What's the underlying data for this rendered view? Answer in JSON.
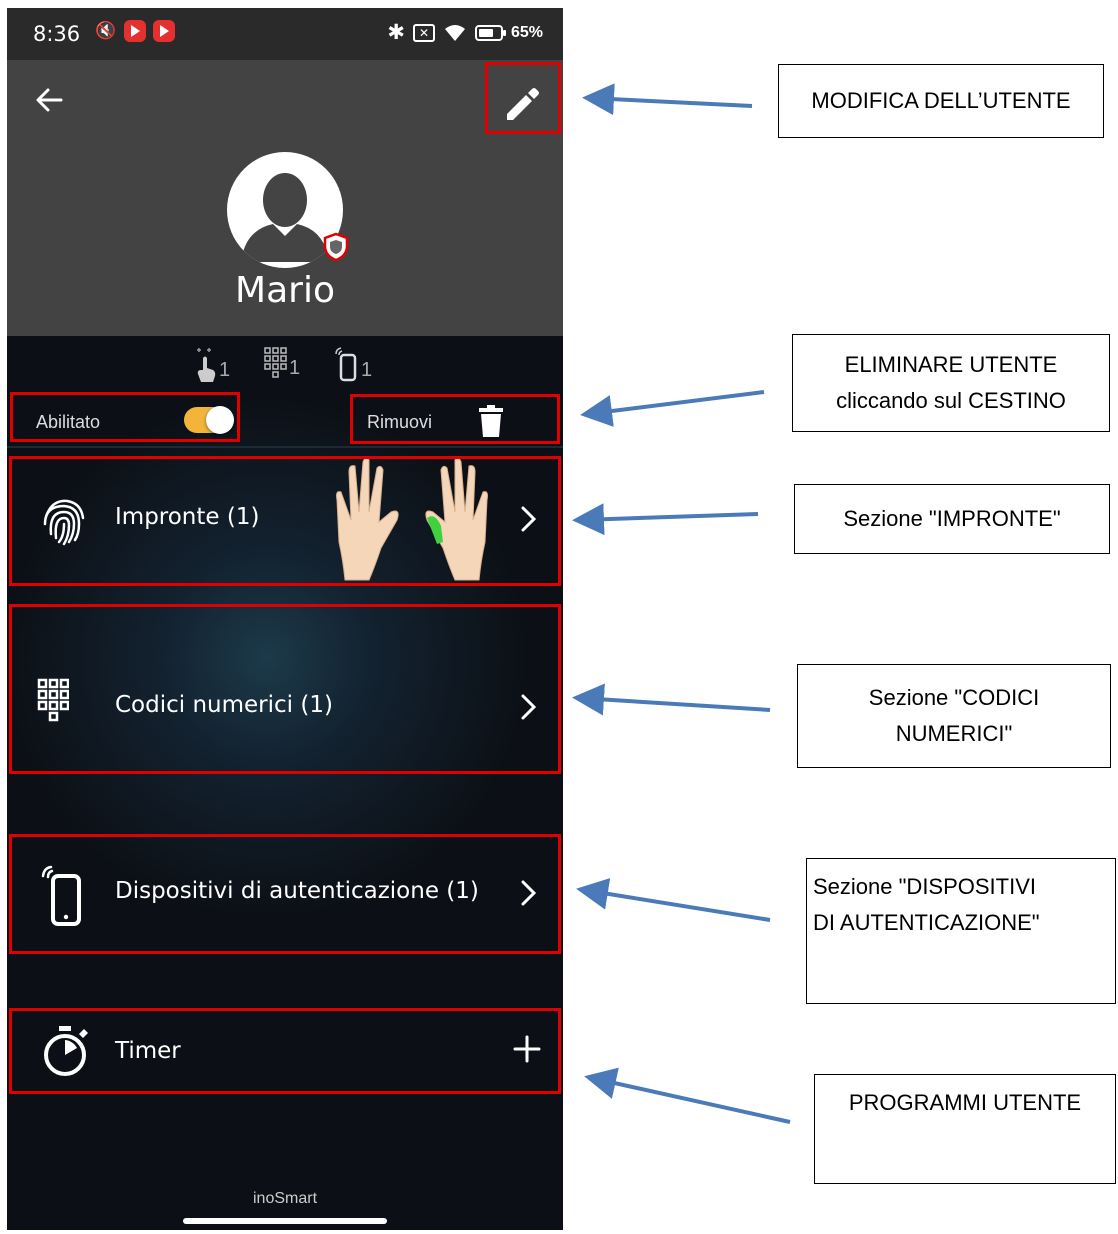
{
  "status_bar": {
    "time": "8:36",
    "battery": "65%"
  },
  "user": {
    "name": "Mario"
  },
  "counts": {
    "fingerprints": "1",
    "codes": "1",
    "devices": "1"
  },
  "controls": {
    "enabled_label": "Abilitato",
    "enabled": true,
    "remove_label": "Rimuovi"
  },
  "sections": {
    "fingerprints": "Impronte (1)",
    "codes": "Codici numerici (1)",
    "devices": "Dispositivi di autenticazione (1)",
    "timer": "Timer"
  },
  "footer": {
    "brand": "inoSmart"
  },
  "colors": {
    "highlight": "#e00000",
    "arrow": "#4a7ab8",
    "toggle": "#f2b53a",
    "header": "#434343"
  },
  "annotations": {
    "edit_user": "MODIFICA DELL’UTENTE",
    "delete_user_line1": "ELIMINARE UTENTE",
    "delete_user_line2": "cliccando sul CESTINO",
    "fingerprints_section": "Sezione \"IMPRONTE\"",
    "codes_section_line1": "Sezione \"CODICI",
    "codes_section_line2": "NUMERICI\"",
    "devices_section_line1": "Sezione \"DISPOSITIVI",
    "devices_section_line2": "DI AUTENTICAZIONE\"",
    "programs": "PROGRAMMI UTENTE"
  }
}
